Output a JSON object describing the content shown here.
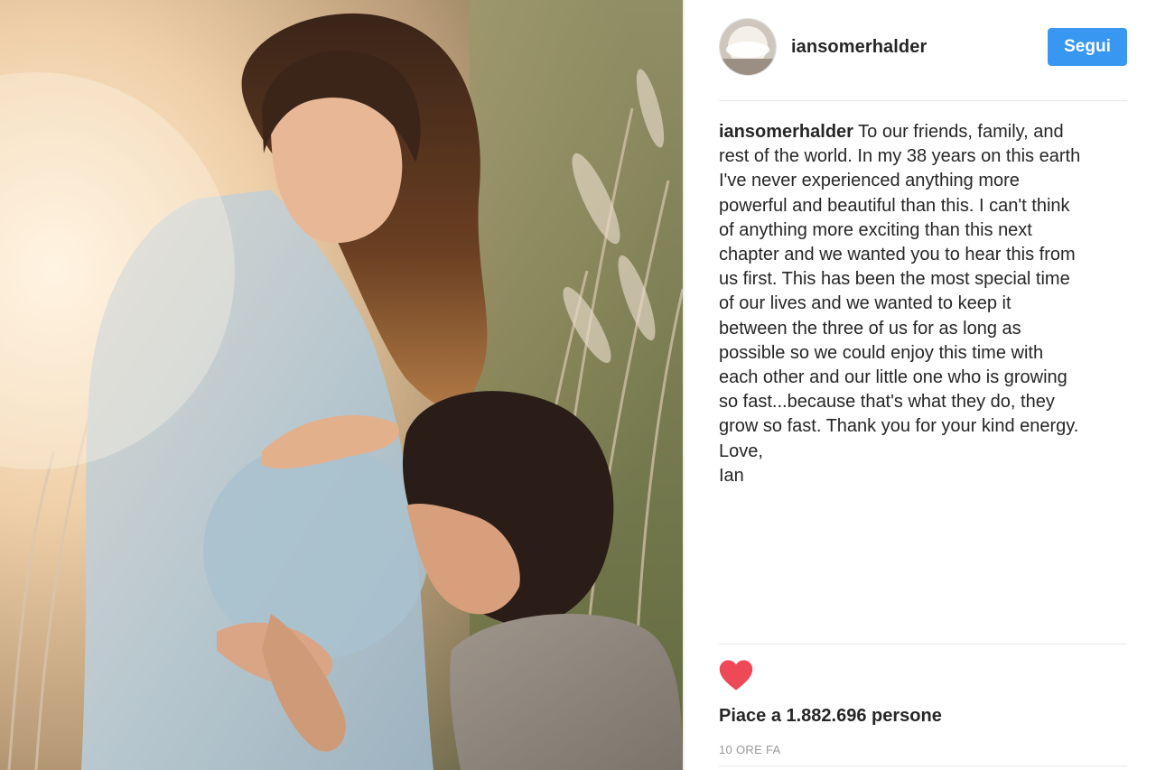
{
  "post": {
    "username": "iansomerhalder",
    "follow_label": "Segui",
    "caption_user": "iansomerhalder",
    "caption_lines": [
      " To our friends, family, and",
      "rest of the world. In my 38 years on this earth",
      "I've never experienced anything more",
      "powerful and beautiful than this. I can't think",
      "of anything more exciting than this next",
      "chapter and we wanted you to hear this from",
      "us first. This has been the most special time",
      "of our lives and we wanted to keep it",
      "between the three of us for as long as",
      "possible so we could enjoy this time with",
      "each other and our little one who is growing",
      "so fast...because that's what they do, they",
      "grow so fast. Thank you for your kind energy.",
      "Love,",
      "Ian"
    ],
    "likes_text": "Piace a 1.882.696 persone",
    "time_text": "10 ORE FA"
  },
  "colors": {
    "accent": "#3897f0",
    "heart": "#ed4956",
    "text": "#262626",
    "muted": "#999999"
  },
  "icons": {
    "like": "heart-icon"
  }
}
